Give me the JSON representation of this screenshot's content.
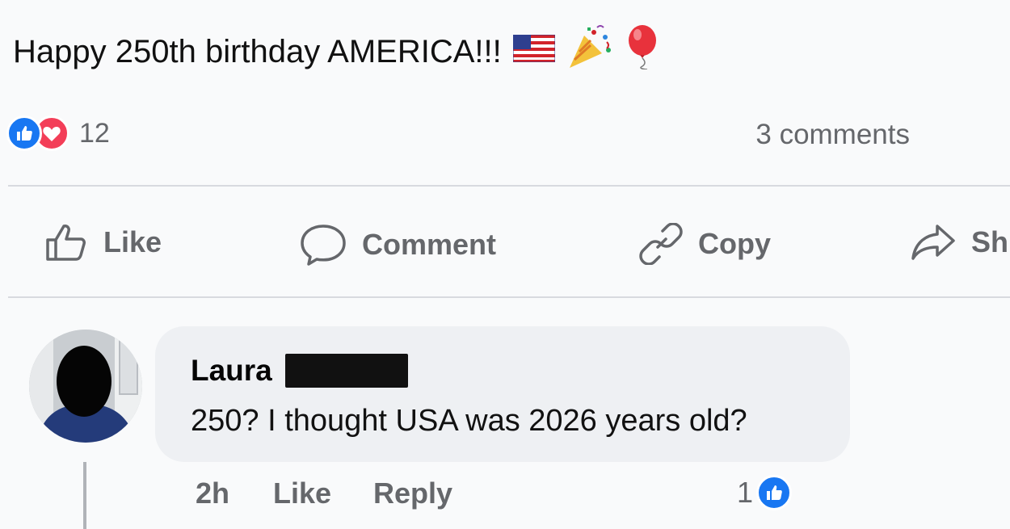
{
  "post": {
    "text": "Happy 250th birthday AMERICA!!!",
    "emojis": [
      "us-flag-icon",
      "party-popper-icon",
      "balloon-icon"
    ]
  },
  "reactions": {
    "count": "12",
    "types": [
      "like-icon",
      "love-icon"
    ],
    "colors": {
      "like": "#1877f2",
      "love": "#f33e58"
    }
  },
  "comments_count": "3 comments",
  "actions": {
    "like": "Like",
    "comment": "Comment",
    "copy": "Copy",
    "share": "Sh"
  },
  "comment": {
    "author": "Laura",
    "text": "250? I thought USA was 2026 years old?",
    "time": "2h",
    "like_label": "Like",
    "reply_label": "Reply",
    "likes": "1"
  }
}
